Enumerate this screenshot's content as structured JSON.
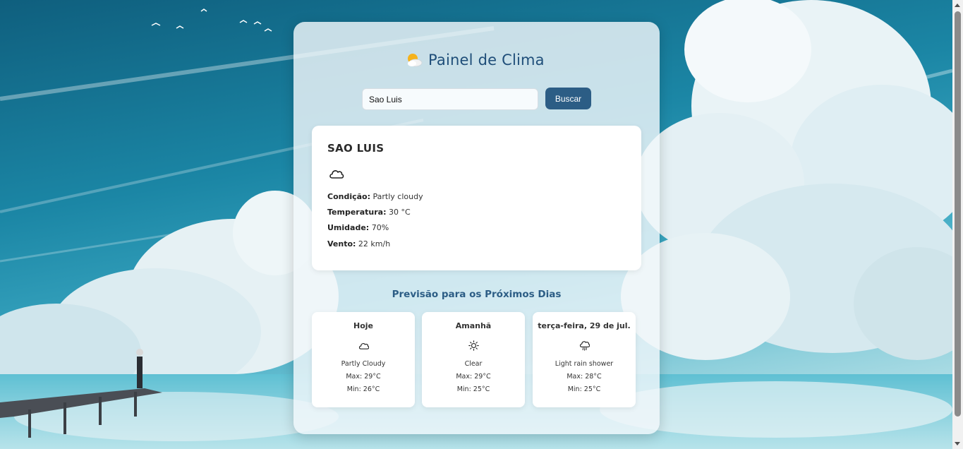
{
  "app": {
    "title": "Painel de Clima",
    "title_icon": "sun-behind-cloud-icon"
  },
  "search": {
    "value": "Sao Luis",
    "button_label": "Buscar"
  },
  "current": {
    "city": "SAO LUIS",
    "icon": "cloud-icon",
    "condition_label": "Condição:",
    "condition_value": "Partly cloudy",
    "temperature_label": "Temperatura:",
    "temperature_value": "30 °C",
    "humidity_label": "Umidade:",
    "humidity_value": "70%",
    "wind_label": "Vento:",
    "wind_value": "22 km/h"
  },
  "forecast": {
    "title": "Previsão para os Próximos Dias",
    "days": [
      {
        "name": "Hoje",
        "icon": "cloud-icon",
        "condition": "Partly Cloudy",
        "max": "Max: 29°C",
        "min": "Min: 26°C"
      },
      {
        "name": "Amanhã",
        "icon": "sun-icon",
        "condition": "Clear",
        "max": "Max: 29°C",
        "min": "Min: 25°C"
      },
      {
        "name": "terça-feira, 29 de jul.",
        "icon": "cloud-rain-icon",
        "condition": "Light rain shower",
        "max": "Max: 28°C",
        "min": "Min: 25°C"
      }
    ]
  },
  "colors": {
    "accent": "#2c5d85",
    "title": "#1f4e79"
  }
}
